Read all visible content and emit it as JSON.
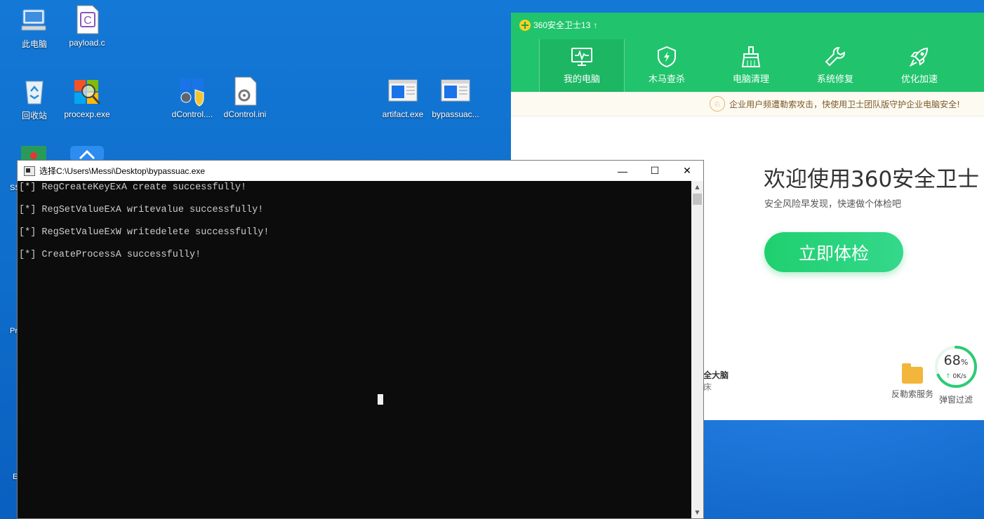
{
  "desktop": {
    "icons": [
      {
        "label": "此电脑",
        "icon": "computer-icon"
      },
      {
        "label": "payload.c",
        "icon": "c-file-icon"
      },
      {
        "label": "回收站",
        "icon": "recycle-bin-icon"
      },
      {
        "label": "procexp.exe",
        "icon": "procexp-icon"
      },
      {
        "label": "dControl....",
        "icon": "dcontrol-shield-icon"
      },
      {
        "label": "dControl.ini",
        "icon": "settings-file-icon"
      },
      {
        "label": "artifact.exe",
        "icon": "exe-window-icon"
      },
      {
        "label": "bypassuac...",
        "icon": "exe-window-icon"
      }
    ],
    "edge_fragments": [
      "SS",
      "Pr",
      "E"
    ]
  },
  "app360": {
    "title": "360安全卫士13",
    "tabs": [
      {
        "label": "我的电脑",
        "icon": "monitor-pulse-icon",
        "active": true
      },
      {
        "label": "木马查杀",
        "icon": "shield-bolt-icon",
        "active": false
      },
      {
        "label": "电脑清理",
        "icon": "broom-icon",
        "active": false
      },
      {
        "label": "系统修复",
        "icon": "wrench-icon",
        "active": false
      },
      {
        "label": "优化加速",
        "icon": "rocket-icon",
        "active": false
      }
    ],
    "notice": "企业用户频遭勒索攻击，快使用卫士团队版守护企业电脑安全!",
    "welcome": "欢迎使用360安全卫士",
    "subtitle": "安全风险早发现，快速做个体检吧",
    "check_button": "立即体检",
    "partial_text": "全大脑",
    "partial_text2": "床",
    "service_label": "反勒索服务",
    "gauge_percent": "68",
    "gauge_unit": "%",
    "gauge_speed": "0K/s",
    "gauge_label": "弹窗过滤",
    "gauge_value": 0.68,
    "colors": {
      "brand_green": "#21c46c",
      "button_green": "#1fd06f"
    }
  },
  "console": {
    "title": "选择C:\\Users\\Messi\\Desktop\\bypassuac.exe",
    "lines": [
      "[*] RegCreateKeyExA create successfully!",
      "[*] RegSetValueExA writevalue successfully!",
      "[*] RegSetValueExW writedelete successfully!",
      "[*] CreateProcessA successfully!"
    ],
    "minimize": "—",
    "maximize": "☐",
    "close": "✕"
  }
}
